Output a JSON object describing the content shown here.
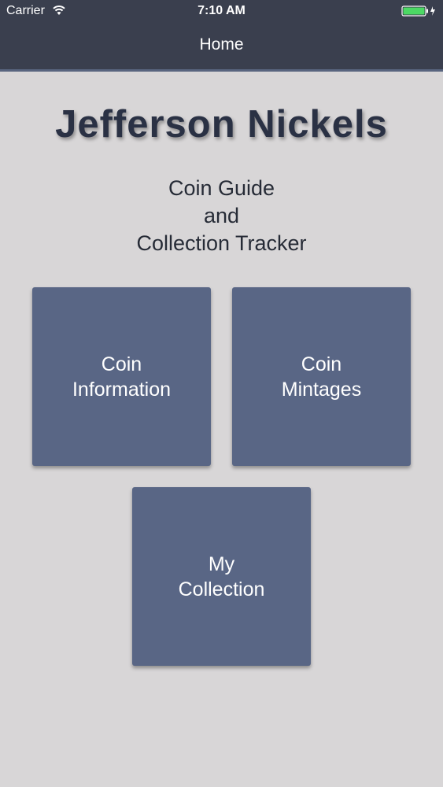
{
  "status_bar": {
    "carrier": "Carrier",
    "time": "7:10 AM",
    "wifi_icon": "wifi-icon",
    "battery_icon": "battery-charging-icon",
    "battery_color": "#4cd964"
  },
  "nav": {
    "title": "Home"
  },
  "header": {
    "title": "Jefferson Nickels",
    "subtitle_lines": [
      "Coin Guide",
      "and",
      "Collection Tracker"
    ]
  },
  "tiles": [
    {
      "lines": [
        "Coin",
        "Information"
      ]
    },
    {
      "lines": [
        "Coin",
        "Mintages"
      ]
    },
    {
      "lines": [
        "My",
        "Collection"
      ]
    }
  ],
  "colors": {
    "nav_background": "#3a3f4e",
    "tile_background": "#596685",
    "page_background": "#d8d6d7",
    "title_color": "#2a3144"
  }
}
